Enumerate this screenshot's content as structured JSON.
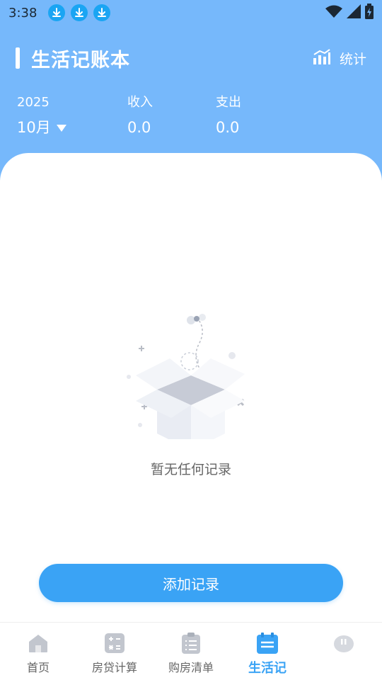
{
  "status": {
    "time": "3:38"
  },
  "header": {
    "title": "生活记账本",
    "stats_label": "统计"
  },
  "summary": {
    "year": "2025",
    "month": "10月",
    "income_label": "收入",
    "income_value": "0.0",
    "expense_label": "支出",
    "expense_value": "0.0"
  },
  "empty": {
    "text": "暂无任何记录"
  },
  "actions": {
    "add_label": "添加记录"
  },
  "tabs": [
    {
      "label": "首页",
      "icon": "home-icon"
    },
    {
      "label": "房贷计算",
      "icon": "calculator-icon"
    },
    {
      "label": "购房清单",
      "icon": "clipboard-icon"
    },
    {
      "label": "生活记",
      "icon": "calendar-icon",
      "active": true
    },
    {
      "label": "",
      "icon": "piggy-bank-icon"
    }
  ],
  "colors": {
    "header_bg": "#76b8fb",
    "accent": "#3aa3f5",
    "download_badge": "#1aa5f3"
  }
}
